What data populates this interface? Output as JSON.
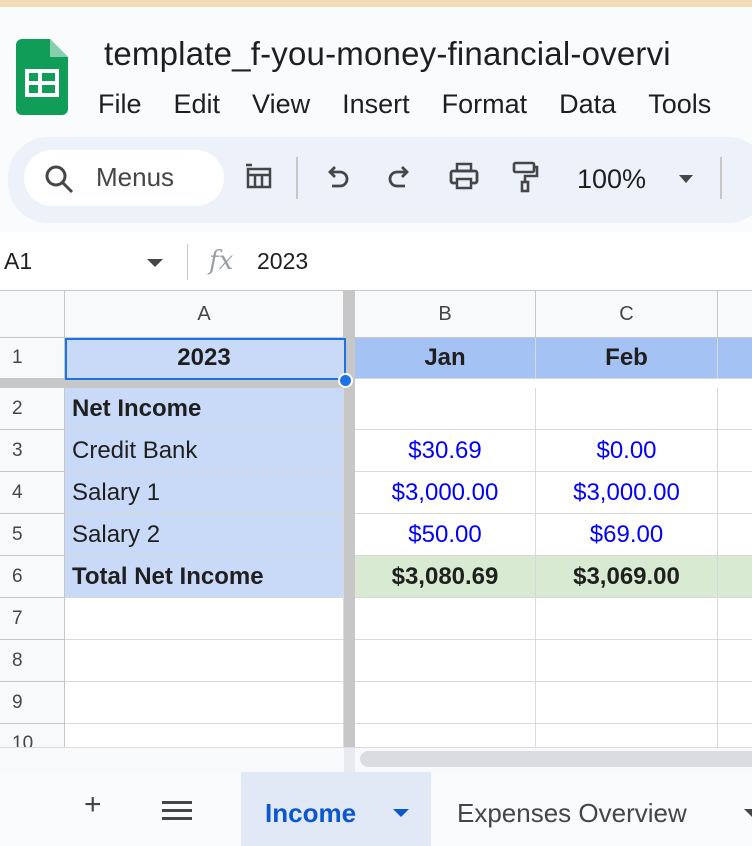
{
  "app": {
    "doc_title": "template_f-you-money-financial-overvi",
    "menus": [
      "File",
      "Edit",
      "View",
      "Insert",
      "Format",
      "Data",
      "Tools"
    ]
  },
  "toolbar": {
    "search_label": "Menus",
    "zoom": "100%"
  },
  "formula_bar": {
    "cell_ref": "A1",
    "fx_label": "fx",
    "value": "2023"
  },
  "grid": {
    "columns": [
      "A",
      "B",
      "C"
    ],
    "row_numbers": [
      "1",
      "2",
      "3",
      "4",
      "5",
      "6",
      "7",
      "8",
      "9",
      "10"
    ],
    "rows": [
      [
        "2023",
        "Jan",
        "Feb"
      ],
      [
        "Net Income",
        "",
        ""
      ],
      [
        "Credit Bank",
        "$30.69",
        "$0.00"
      ],
      [
        "Salary 1",
        "$3,000.00",
        "$3,000.00"
      ],
      [
        "Salary 2",
        "$50.00",
        "$69.00"
      ],
      [
        "Total Net Income",
        "$3,080.69",
        "$3,069.00"
      ]
    ]
  },
  "sheets": {
    "add_label": "+",
    "active": "Income",
    "other": "Expenses Overview"
  },
  "colors": {
    "header_blue": "#a4c2f4",
    "label_blue": "#c9daf8",
    "total_green": "#d9ead3",
    "value_blue": "#0000ff",
    "selection": "#1a73e8"
  }
}
